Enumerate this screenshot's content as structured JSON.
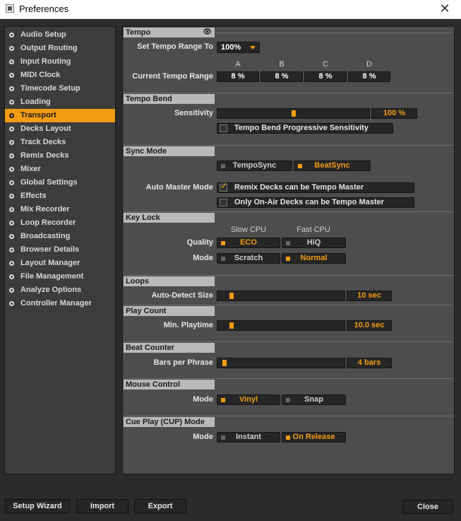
{
  "window": {
    "title": "Preferences"
  },
  "sidebar": {
    "items": [
      {
        "label": "Audio Setup",
        "active": false
      },
      {
        "label": "Output Routing",
        "active": false
      },
      {
        "label": "Input Routing",
        "active": false
      },
      {
        "label": "MIDI Clock",
        "active": false
      },
      {
        "label": "Timecode Setup",
        "active": false
      },
      {
        "label": "Loading",
        "active": false
      },
      {
        "label": "Transport",
        "active": true
      },
      {
        "label": "Decks Layout",
        "active": false
      },
      {
        "label": "Track Decks",
        "active": false
      },
      {
        "label": "Remix Decks",
        "active": false
      },
      {
        "label": "Mixer",
        "active": false
      },
      {
        "label": "Global Settings",
        "active": false
      },
      {
        "label": "Effects",
        "active": false
      },
      {
        "label": "Mix Recorder",
        "active": false
      },
      {
        "label": "Loop Recorder",
        "active": false
      },
      {
        "label": "Broadcasting",
        "active": false
      },
      {
        "label": "Browser Details",
        "active": false
      },
      {
        "label": "Layout Manager",
        "active": false
      },
      {
        "label": "File Management",
        "active": false
      },
      {
        "label": "Analyze Options",
        "active": false
      },
      {
        "label": "Controller Manager",
        "active": false
      }
    ]
  },
  "tempo": {
    "header": "Tempo",
    "range_label": "Set Tempo Range To",
    "range_value": "100%",
    "current_label": "Current Tempo Range",
    "decks": [
      {
        "name": "A",
        "value": "8 %"
      },
      {
        "name": "B",
        "value": "8 %"
      },
      {
        "name": "C",
        "value": "8 %"
      },
      {
        "name": "D",
        "value": "8 %"
      }
    ]
  },
  "tempo_bend": {
    "header": "Tempo Bend",
    "sensitivity_label": "Sensitivity",
    "sensitivity_value": "100 %",
    "sensitivity_level": 0.5,
    "progressive_label": "Tempo Bend Progressive Sensitivity",
    "progressive_checked": false
  },
  "sync_mode": {
    "header": "Sync Mode",
    "tempo_sync": "TempoSync",
    "beat_sync": "BeatSync",
    "selected": "BeatSync",
    "auto_master_label": "Auto Master Mode",
    "remix_master": "Remix Decks can be Tempo Master",
    "remix_master_checked": true,
    "on_air_master": "Only On-Air Decks can be Tempo Master",
    "on_air_master_checked": false
  },
  "key_lock": {
    "header": "Key Lock",
    "slow_cpu": "Slow CPU",
    "fast_cpu": "Fast CPU",
    "quality_label": "Quality",
    "eco": "ECO",
    "hiq": "HiQ",
    "quality_selected": "ECO",
    "mode_label": "Mode",
    "scratch": "Scratch",
    "normal": "Normal",
    "mode_selected": "Normal"
  },
  "loops": {
    "header": "Loops",
    "auto_detect_label": "Auto-Detect Size",
    "auto_detect_value": "10 sec",
    "auto_detect_level": 0.1
  },
  "play_count": {
    "header": "Play Count",
    "min_playtime_label": "Min. Playtime",
    "min_playtime_value": "10.0 sec",
    "min_playtime_level": 0.1
  },
  "beat_counter": {
    "header": "Beat Counter",
    "bars_label": "Bars per Phrase",
    "bars_value": "4 bars",
    "bars_level": 0.04
  },
  "mouse_control": {
    "header": "Mouse Control",
    "mode_label": "Mode",
    "vinyl": "Vinyl",
    "snap": "Snap",
    "selected": "Vinyl"
  },
  "cue_play": {
    "header": "Cue Play (CUP) Mode",
    "mode_label": "Mode",
    "instant": "Instant",
    "on_release": "On Release",
    "selected": "On Release"
  },
  "footer": {
    "setup_wizard": "Setup Wizard",
    "import": "Import",
    "export": "Export",
    "close": "Close"
  },
  "colors": {
    "accent": "#f39c12",
    "panel_bg": "#4d4d4d",
    "window_bg": "#2b2b2b",
    "section_header": "#b9b9b9"
  },
  "icons": {
    "app": "preferences-app-icon",
    "close": "close-icon",
    "tempo_eye": "eye-icon"
  }
}
